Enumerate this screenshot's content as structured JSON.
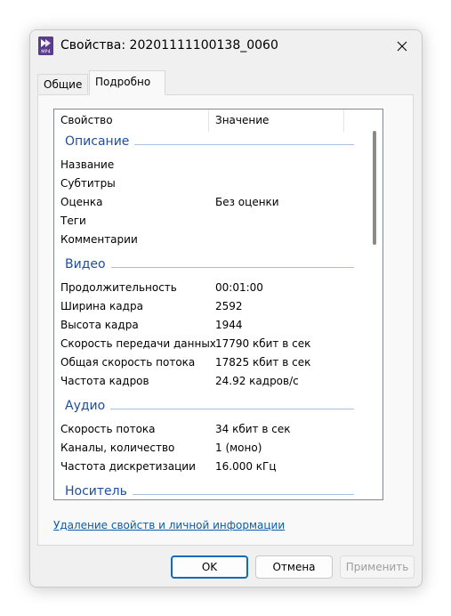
{
  "window": {
    "title": "Свойства: 20201111100138_0060",
    "icon": "mp4-file-icon",
    "icon_caption": "MP4",
    "close_icon": "close-icon"
  },
  "tabs": [
    {
      "label": "Общие",
      "selected": false
    },
    {
      "label": "Подробно",
      "selected": true
    }
  ],
  "list": {
    "headers": {
      "property": "Свойство",
      "value": "Значение"
    },
    "groups": [
      {
        "name": "Описание",
        "items": [
          {
            "name": "Название",
            "value": ""
          },
          {
            "name": "Субтитры",
            "value": ""
          },
          {
            "name": "Оценка",
            "value": "Без оценки"
          },
          {
            "name": "Теги",
            "value": ""
          },
          {
            "name": "Комментарии",
            "value": ""
          }
        ]
      },
      {
        "name": "Видео",
        "items": [
          {
            "name": "Продолжительность",
            "value": "00:01:00"
          },
          {
            "name": "Ширина кадра",
            "value": "2592"
          },
          {
            "name": "Высота кадра",
            "value": "1944"
          },
          {
            "name": "Скорость передачи данных",
            "value": "17790 кбит в сек"
          },
          {
            "name": "Общая скорость потока",
            "value": "17825 кбит в сек"
          },
          {
            "name": "Частота кадров",
            "value": "24.92 кадров/с"
          }
        ]
      },
      {
        "name": "Аудио",
        "items": [
          {
            "name": "Скорость потока",
            "value": "34 кбит в сек"
          },
          {
            "name": "Каналы, количество",
            "value": "1 (моно)"
          },
          {
            "name": "Частота дискретизации",
            "value": "16.000 кГц"
          }
        ]
      },
      {
        "name": "Носитель",
        "items": []
      }
    ]
  },
  "link": {
    "remove_properties": "Удаление свойств и личной информации"
  },
  "buttons": {
    "ok": "OK",
    "cancel": "Отмена",
    "apply": "Применить"
  },
  "colors": {
    "accent": "#0f6cbd",
    "group_header": "#1f4e9a",
    "link": "#0b5cad"
  }
}
